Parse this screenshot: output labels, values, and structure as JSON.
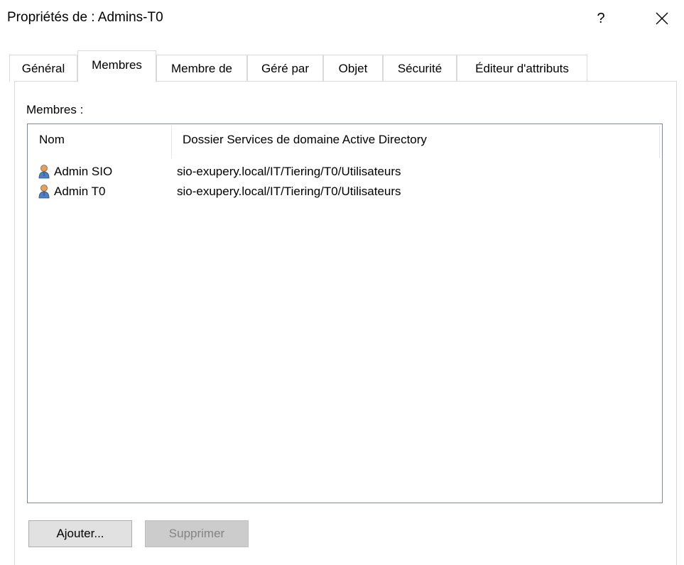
{
  "window": {
    "title": "Propriétés de : Admins-T0",
    "help_label": "?"
  },
  "tabs": [
    {
      "label": "Général"
    },
    {
      "label": "Membres"
    },
    {
      "label": "Membre de"
    },
    {
      "label": "Géré par"
    },
    {
      "label": "Objet"
    },
    {
      "label": "Sécurité"
    },
    {
      "label": "Éditeur d'attributs"
    }
  ],
  "active_tab": "Membres",
  "members": {
    "label": "Membres :",
    "columns": [
      "Nom",
      "Dossier Services de domaine Active Directory"
    ],
    "rows": [
      {
        "icon": "user-icon",
        "name": "Admin SIO",
        "folder": "sio-exupery.local/IT/Tiering/T0/Utilisateurs"
      },
      {
        "icon": "user-icon",
        "name": "Admin T0",
        "folder": "sio-exupery.local/IT/Tiering/T0/Utilisateurs"
      }
    ]
  },
  "buttons": {
    "add_label": "Ajouter...",
    "remove_label": "Supprimer"
  },
  "colors": {
    "button_bg": "#e1e1e1",
    "disabled_bg": "#cccccc",
    "disabled_text": "#838383"
  }
}
